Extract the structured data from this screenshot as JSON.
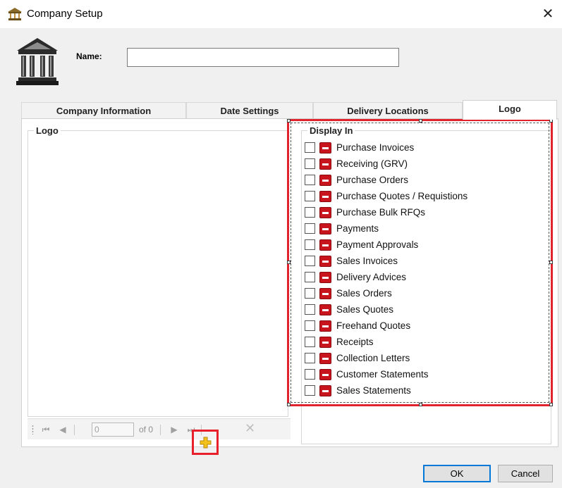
{
  "window": {
    "title": "Company Setup",
    "close_glyph": "✕"
  },
  "name_field": {
    "label": "Name:",
    "value": ""
  },
  "tabs": [
    {
      "label": "Company Information",
      "active": false
    },
    {
      "label": "Date Settings",
      "active": false
    },
    {
      "label": "Delivery Locations",
      "active": false
    },
    {
      "label": "Logo",
      "active": true
    }
  ],
  "logo_panel": {
    "title": "Logo",
    "navigator": {
      "position_value": "0",
      "of_text": "of 0",
      "first_glyph": "⏮",
      "prev_glyph": "◀",
      "next_glyph": "▶",
      "last_glyph": "⏭",
      "delete_glyph": "✕"
    }
  },
  "display_in": {
    "title": "Display In",
    "items": [
      {
        "label": "Purchase Invoices",
        "checked": false
      },
      {
        "label": "Receiving (GRV)",
        "checked": false
      },
      {
        "label": "Purchase Orders",
        "checked": false
      },
      {
        "label": "Purchase Quotes / Requistions",
        "checked": false
      },
      {
        "label": "Purchase Bulk RFQs",
        "checked": false
      },
      {
        "label": "Payments",
        "checked": false
      },
      {
        "label": "Payment Approvals",
        "checked": false
      },
      {
        "label": "Sales Invoices",
        "checked": false
      },
      {
        "label": "Delivery Advices",
        "checked": false
      },
      {
        "label": "Sales Orders",
        "checked": false
      },
      {
        "label": "Sales Quotes",
        "checked": false
      },
      {
        "label": "Freehand Quotes",
        "checked": false
      },
      {
        "label": "Receipts",
        "checked": false
      },
      {
        "label": "Collection Letters",
        "checked": false
      },
      {
        "label": "Customer Statements",
        "checked": false
      },
      {
        "label": "Sales Statements",
        "checked": false
      }
    ]
  },
  "buttons": {
    "ok": "OK",
    "cancel": "Cancel"
  },
  "colors": {
    "accent": "#0078d7",
    "highlight": "#e0232d",
    "minus_icon": "#c8141d"
  }
}
